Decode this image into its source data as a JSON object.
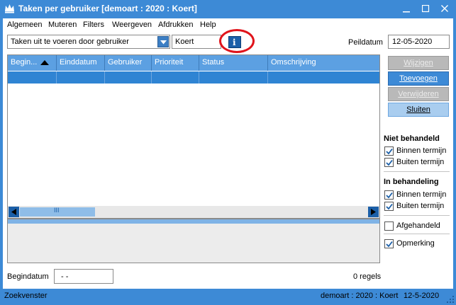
{
  "window": {
    "title": "Taken per gebruiker  [demoart : 2020 : Koert]",
    "colors": {
      "accent": "#3d8ad6",
      "header": "#5ca0e2",
      "selected_row": "#2f84d3",
      "annotation": "#e0141b"
    }
  },
  "menu": [
    "Algemeen",
    "Muteren",
    "Filters",
    "Weergeven",
    "Afdrukken",
    "Help"
  ],
  "toolbar": {
    "view_select": "Taken uit te voeren door gebruiker",
    "user_value": "Koert",
    "info_icon": "i",
    "peildatum_label": "Peildatum",
    "peildatum_value": "12-05-2020"
  },
  "grid": {
    "columns": [
      "Begin...",
      "Einddatum",
      "Gebruiker",
      "Prioriteit",
      "Status",
      "Omschrijving"
    ],
    "sort": "ascending",
    "scroll_thumb": "III"
  },
  "actions": {
    "wijzigen": "Wijzigen",
    "toevoegen": "Toevoegen",
    "verwijderen": "Verwijderen",
    "sluiten": "Sluiten"
  },
  "filters": {
    "niet_behandeld": {
      "title": "Niet behandeld",
      "binnen": "Binnen termijn",
      "buiten": "Buiten termijn",
      "binnen_checked": true,
      "buiten_checked": true
    },
    "in_behandeling": {
      "title": "In behandeling",
      "binnen": "Binnen termijn",
      "buiten": "Buiten termijn",
      "binnen_checked": true,
      "buiten_checked": true
    },
    "afgehandeld": {
      "label": "Afgehandeld",
      "checked": false
    },
    "opmerking": {
      "label": "Opmerking",
      "checked": true
    }
  },
  "footer": {
    "begindatum_label": "Begindatum",
    "begindatum_value": "-  -",
    "row_count": "0 regels"
  },
  "status": {
    "left": "Zoekvenster",
    "right": "demoart : 2020 : Koert",
    "date": "12-5-2020"
  }
}
